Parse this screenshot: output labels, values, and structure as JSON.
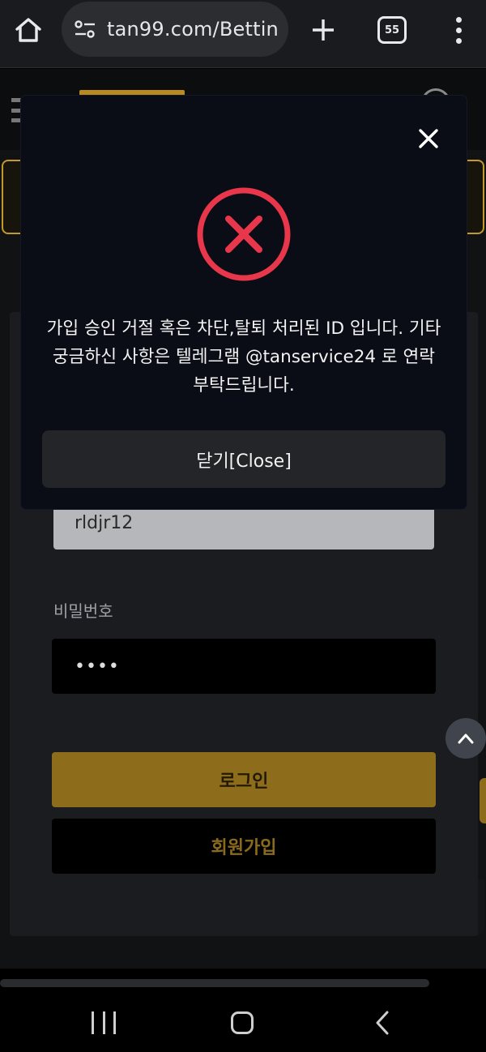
{
  "browser": {
    "url": "tan99.com/Bettin",
    "tab_count": "55"
  },
  "modal": {
    "message_lines": [
      "가입 승인 거절 혹은 차단,탈퇴 처리된 ID 입니다. 기타",
      "궁금하신 사항은 텔레그램 @tanservice24 로 연락",
      "부탁드립니다."
    ],
    "close_button_label": "닫기[Close]",
    "icon": "error-x-circle-icon",
    "accent_color": "#e8364b"
  },
  "login_form": {
    "id_value": "rldjr12",
    "password_label": "비밀번호",
    "password_value": "••••",
    "login_button_label": "로그인",
    "signup_button_label": "회원가입",
    "brand_color": "#8d6d1c"
  },
  "icons": {
    "home": "home-icon",
    "site_settings": "tune-icon",
    "new_tab": "plus-icon",
    "more": "more-vert-icon",
    "scroll_top": "chevron-up-icon",
    "nav_recents": "recents-icon",
    "nav_home": "home-button-icon",
    "nav_back": "back-icon"
  }
}
